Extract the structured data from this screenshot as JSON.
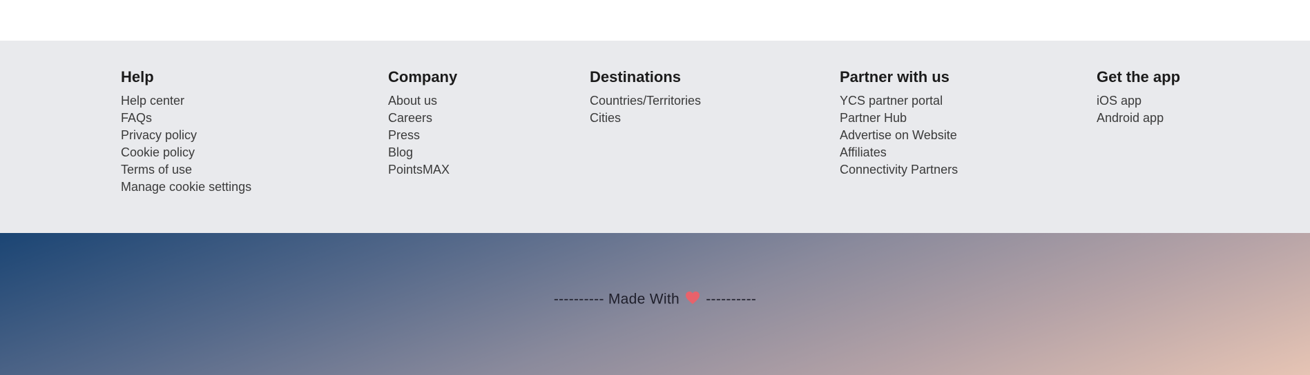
{
  "columns": {
    "help": {
      "title": "Help",
      "items": [
        "Help center",
        "FAQs",
        "Privacy policy",
        "Cookie policy",
        "Terms of use",
        "Manage cookie settings"
      ]
    },
    "company": {
      "title": "Company",
      "items": [
        "About us",
        "Careers",
        "Press",
        "Blog",
        "PointsMAX"
      ]
    },
    "destinations": {
      "title": "Destinations",
      "items": [
        "Countries/Territories",
        "Cities"
      ]
    },
    "partner": {
      "title": "Partner with us",
      "items": [
        "YCS partner portal",
        "Partner Hub",
        "Advertise on Website",
        "Affiliates",
        "Connectivity Partners"
      ]
    },
    "app": {
      "title": "Get the app",
      "items": [
        "iOS app",
        "Android app"
      ]
    }
  },
  "banner": {
    "dashes_left": "----------",
    "text": "Made With",
    "icon": "heart-icon",
    "dashes_right": "----------"
  },
  "colors": {
    "footer_bg": "#e9eaed",
    "heart": "#e8626b"
  }
}
